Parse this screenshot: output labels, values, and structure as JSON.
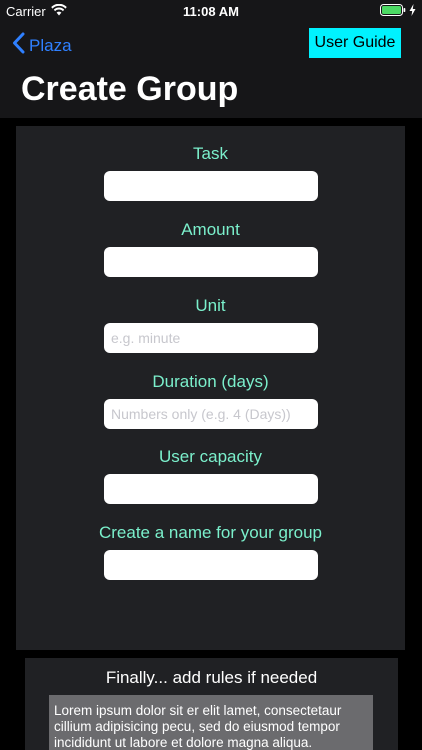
{
  "status": {
    "carrier": "Carrier",
    "time": "11:08 AM"
  },
  "nav": {
    "back_label": "Plaza",
    "guide_label": "User Guide",
    "title": "Create Group"
  },
  "form": {
    "task": {
      "label": "Task",
      "value": "",
      "placeholder": ""
    },
    "amount": {
      "label": "Amount",
      "value": "",
      "placeholder": ""
    },
    "unit": {
      "label": "Unit",
      "value": "",
      "placeholder": "e.g. minute"
    },
    "duration": {
      "label": "Duration (days)",
      "value": "",
      "placeholder": "Numbers only (e.g. 4 (Days))"
    },
    "capacity": {
      "label": "User capacity",
      "value": "",
      "placeholder": ""
    },
    "group_name": {
      "label": "Create a name for your group",
      "value": "",
      "placeholder": ""
    }
  },
  "rules": {
    "title": "Finally... add rules if needed",
    "text": "Lorem ipsum dolor sit er elit lamet, consectetaur cillium adipisicing pecu, sed do eiusmod tempor incididunt ut labore et dolore magna aliqua."
  },
  "colors": {
    "accent_blue": "#2f80ff",
    "guide_button": "#00f2ff",
    "label_mint": "#7bf0cc",
    "panel": "#202124",
    "header": "#161618"
  },
  "icons": [
    "wifi-icon",
    "chevron-left-icon",
    "battery-icon",
    "charging-bolt-icon"
  ]
}
